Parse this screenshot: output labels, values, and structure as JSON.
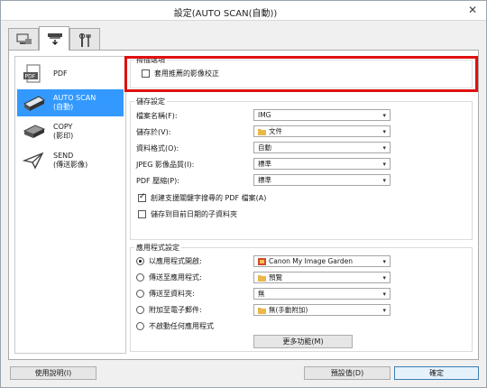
{
  "window": {
    "title": "設定(AUTO SCAN(自動))",
    "close_glyph": "✕"
  },
  "tabs": [
    {
      "name": "scan-from-computer",
      "icon": "computer-scan-icon",
      "active": false
    },
    {
      "name": "scan-from-panel",
      "icon": "scanner-panel-icon",
      "active": true
    },
    {
      "name": "general-settings",
      "icon": "tools-icon",
      "active": false
    }
  ],
  "sidebar": {
    "items": [
      {
        "label": "PDF",
        "icon": "pdf-icon",
        "selected": false
      },
      {
        "label": "AUTO SCAN\n(自動)",
        "icon": "scanner-icon",
        "selected": true
      },
      {
        "label": "COPY\n(影印)",
        "icon": "copy-icon",
        "selected": false
      },
      {
        "label": "SEND\n(傳送影像)",
        "icon": "send-icon",
        "selected": false
      }
    ]
  },
  "scan_options": {
    "title": "掃描選項",
    "apply_recommended_correction": "套用推薦的影像校正",
    "apply_recommended_correction_checked": false
  },
  "save_settings": {
    "title": "儲存設定",
    "file_name_label": "檔案名稱(F):",
    "file_name_value": "IMG",
    "save_in_label": "儲存於(V):",
    "save_in_value": "文件",
    "data_format_label": "資料格式(O):",
    "data_format_value": "自動",
    "jpeg_quality_label": "JPEG 影像品質(I):",
    "jpeg_quality_value": "標準",
    "pdf_compression_label": "PDF 壓縮(P):",
    "pdf_compression_value": "標準",
    "create_searchable_pdf": "創建支援關鍵字搜尋的 PDF 檔案(A)",
    "create_searchable_pdf_checked": true,
    "save_to_date_subfolder": "儲存到目前日期的子資料夾",
    "save_to_date_subfolder_checked": false
  },
  "app_settings": {
    "title": "應用程式設定",
    "open_with_app_label": "以應用程式開啟:",
    "open_with_app_value": "Canon My Image Garden",
    "send_to_app_label": "傳送至應用程式:",
    "send_to_app_value": "預覽",
    "send_to_folder_label": "傳送至資料夾:",
    "send_to_folder_value": "無",
    "attach_email_label": "附加至電子郵件:",
    "attach_email_value": "無(手動附加)",
    "no_app_label": "不啟動任何應用程式",
    "selected": "open_with_app",
    "more_functions": "更多功能(M)"
  },
  "footer": {
    "help": "使用說明(I)",
    "defaults": "預設值(D)",
    "ok": "確定"
  },
  "colors": {
    "highlight_box": "#e01010",
    "selection": "#3399ff"
  }
}
